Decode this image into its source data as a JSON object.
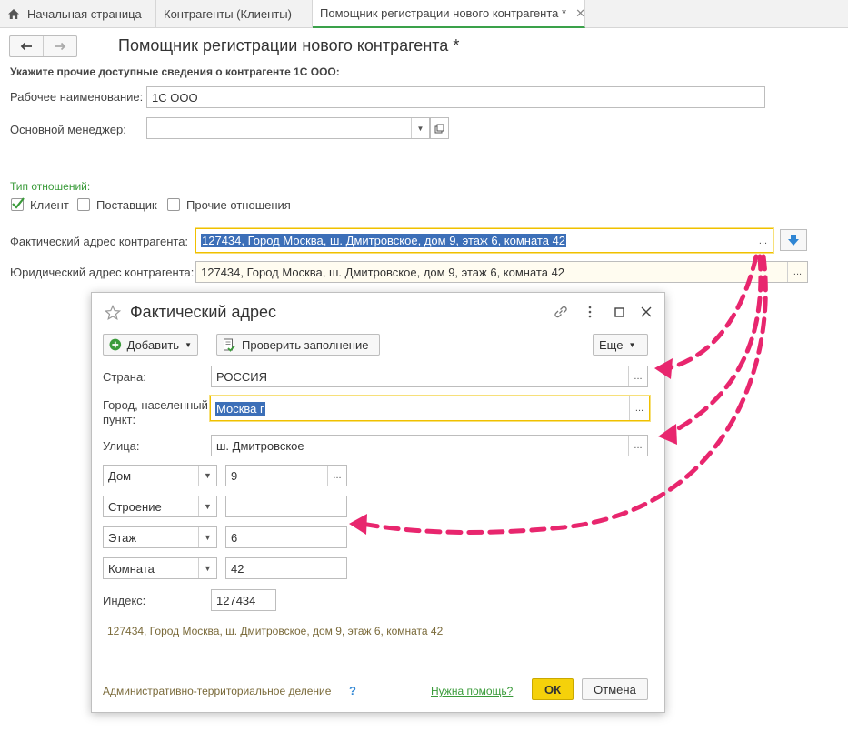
{
  "tabs": [
    {
      "label": "Начальная страница"
    },
    {
      "label": "Контрагенты (Клиенты)"
    },
    {
      "label": "Помощник регистрации нового контрагента *",
      "close": "✕"
    }
  ],
  "form": {
    "title": "Помощник регистрации нового контрагента *",
    "subtitle": "Укажите прочие доступные сведения о контрагенте 1С ООО:",
    "work_name_label": "Рабочее наименование:",
    "work_name_value": "1С ООО",
    "manager_label": "Основной менеджер:",
    "manager_value": "",
    "relation_type_label": "Тип отношений:",
    "relations": [
      {
        "label": "Клиент",
        "checked": true
      },
      {
        "label": "Поставщик",
        "checked": false
      },
      {
        "label": "Прочие отношения",
        "checked": false
      }
    ],
    "actual_address_label": "Фактический адрес контрагента:",
    "actual_address_value": "127434, Город Москва, ш. Дмитровское, дом 9, этаж 6, комната 42",
    "legal_address_label": "Юридический адрес контрагента:",
    "legal_address_value": "127434, Город Москва, ш. Дмитровское, дом 9, этаж 6, комната 42",
    "ellipsis": "..."
  },
  "dialog": {
    "title": "Фактический адрес",
    "add_button": "Добавить",
    "check_button": "Проверить заполнение",
    "more_button": "Еще",
    "country_label": "Страна:",
    "country_value": "РОССИЯ",
    "city_label_1": "Город, населенный",
    "city_label_2": "пункт:",
    "city_value": "Москва г",
    "street_label": "Улица:",
    "street_value": "ш. Дмитровское",
    "rows": [
      {
        "type": "Дом",
        "value": "9"
      },
      {
        "type": "Строение",
        "value": ""
      },
      {
        "type": "Этаж",
        "value": "6"
      },
      {
        "type": "Комната",
        "value": "42"
      }
    ],
    "index_label": "Индекс:",
    "index_value": "127434",
    "full_address": "127434, Город Москва, ш. Дмитровское, дом 9, этаж 6, комната 42",
    "admin_division": "Административно-территориальное деление",
    "help_q": "?",
    "help_link": "Нужна помощь?",
    "ok": "ОК",
    "cancel": "Отмена"
  },
  "colors": {
    "accent_green": "#3a9b3a",
    "highlight_yellow": "#f0c000",
    "arrow_pink": "#e8266e",
    "selection_blue": "#3c6fb8"
  }
}
